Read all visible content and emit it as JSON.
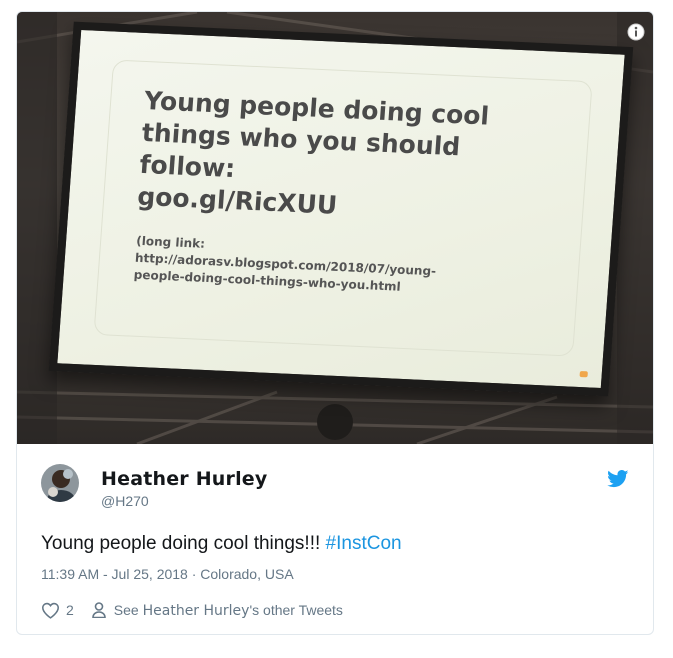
{
  "media": {
    "slide": {
      "title_lines": [
        "Young people doing cool",
        "things who you should follow:",
        "goo.gl/RicXUU"
      ],
      "link_lines": [
        "(long link:",
        "http://adorasv.blogspot.com/2018/07/young-",
        "people-doing-cool-things-who-you.html"
      ]
    },
    "info_icon": "info-icon"
  },
  "tweet": {
    "author_name": "Heather Hurley",
    "author_handle": "@H270",
    "text": "Young people doing cool things!!! ",
    "hashtag": "#InstCon",
    "meta": "11:39 AM - Jul 25, 2018 · Colorado, USA",
    "like_count": "2",
    "see_prefix": "See ",
    "see_name": "Heather Hurley",
    "see_suffix": "'s other Tweets"
  },
  "colors": {
    "hashtag": "#1b95e0",
    "twitter_blue": "#1da1f2",
    "secondary_text": "#657786",
    "primary_text": "#14171a"
  },
  "icons": [
    "info-icon",
    "avatar",
    "twitter-bird-icon",
    "heart-icon",
    "person-icon"
  ]
}
